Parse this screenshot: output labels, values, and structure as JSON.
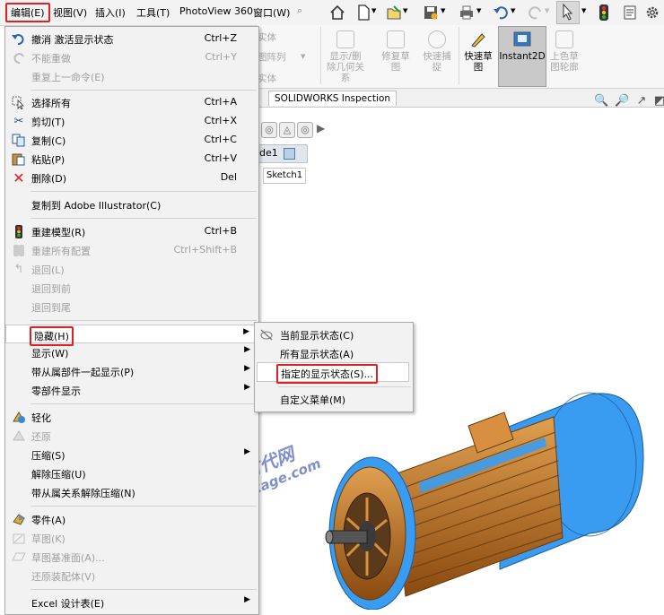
{
  "menubar": {
    "items": [
      "编辑(E)",
      "视图(V)",
      "插入(I)",
      "工具(T)",
      "PhotoView 360",
      "窗口(W)"
    ],
    "icons": [
      "pin-icon",
      "home-icon",
      "new-document-icon",
      "open-icon",
      "save-icon",
      "print-icon",
      "undo-icon",
      "redo-icon",
      "select-arrow-icon",
      "rebuild-traffic-light-icon",
      "file-properties-icon",
      "options-gear-icon"
    ]
  },
  "ribbon": {
    "partial_labels": [
      "实体",
      "图阵列",
      "实体"
    ],
    "buttons": [
      {
        "label": "显示/删除几何关系",
        "enabled": false
      },
      {
        "label": "修复草图",
        "enabled": false
      },
      {
        "label": "快速捕捉",
        "enabled": false
      },
      {
        "label": "快速草图",
        "enabled": true
      },
      {
        "label": "Instant2D",
        "enabled": true,
        "active": true
      },
      {
        "label": "上色草图轮廓",
        "enabled": false
      }
    ]
  },
  "tabs": [
    "SOLIDWORKS Inspection"
  ],
  "canvas": {
    "tree_items": [
      "de1",
      "Sketch1"
    ],
    "watermark_cn": "机械时代网",
    "watermark_url": "www.jxage.com"
  },
  "edit_menu": {
    "items": [
      {
        "label": "撤消 激活显示状态",
        "shortcut": "Ctrl+Z",
        "icon": "undo-icon",
        "enabled": true
      },
      {
        "label": "不能重做",
        "shortcut": "Ctrl+Y",
        "icon": "redo-icon",
        "enabled": false
      },
      {
        "label": "重复上一命令(E)",
        "shortcut": "",
        "icon": "",
        "enabled": false
      },
      {
        "label": "选择所有",
        "shortcut": "Ctrl+A",
        "icon": "select-all-icon",
        "enabled": true
      },
      {
        "label": "剪切(T)",
        "shortcut": "Ctrl+X",
        "icon": "cut-icon",
        "enabled": true
      },
      {
        "label": "复制(C)",
        "shortcut": "Ctrl+C",
        "icon": "copy-icon",
        "enabled": true
      },
      {
        "label": "粘贴(P)",
        "shortcut": "Ctrl+V",
        "icon": "paste-icon",
        "enabled": true
      },
      {
        "label": "删除(D)",
        "shortcut": "Del",
        "icon": "delete-icon",
        "enabled": true
      },
      {
        "label": "复制到 Adobe Illustrator(C)",
        "shortcut": "",
        "icon": "",
        "enabled": true
      },
      {
        "label": "重建模型(R)",
        "shortcut": "Ctrl+B",
        "icon": "rebuild-icon",
        "enabled": true
      },
      {
        "label": "重建所有配置",
        "shortcut": "Ctrl+Shift+B",
        "icon": "rebuild-all-icon",
        "enabled": false
      },
      {
        "label": "退回(L)",
        "shortcut": "",
        "icon": "rollback-icon",
        "enabled": false
      },
      {
        "label": "退回到前",
        "shortcut": "",
        "icon": "",
        "enabled": false
      },
      {
        "label": "退回到尾",
        "shortcut": "",
        "icon": "",
        "enabled": false
      },
      {
        "label": "隐藏(H)",
        "shortcut": "",
        "icon": "",
        "enabled": true,
        "submenu": true
      },
      {
        "label": "显示(W)",
        "shortcut": "",
        "icon": "",
        "enabled": true,
        "submenu": true
      },
      {
        "label": "带从属部件一起显示(P)",
        "shortcut": "",
        "icon": "",
        "enabled": true,
        "submenu": true
      },
      {
        "label": "零部件显示",
        "shortcut": "",
        "icon": "",
        "enabled": true,
        "submenu": true
      },
      {
        "label": "轻化",
        "shortcut": "",
        "icon": "lightweight-icon",
        "enabled": true
      },
      {
        "label": "还原",
        "shortcut": "",
        "icon": "resolve-icon",
        "enabled": false
      },
      {
        "label": "压缩(S)",
        "shortcut": "",
        "icon": "",
        "enabled": true,
        "submenu": true
      },
      {
        "label": "解除压缩(U)",
        "shortcut": "",
        "icon": "",
        "enabled": true
      },
      {
        "label": "带从属关系解除压缩(N)",
        "shortcut": "",
        "icon": "",
        "enabled": true
      },
      {
        "label": "零件(A)",
        "shortcut": "",
        "icon": "part-icon",
        "enabled": true
      },
      {
        "label": "草图(K)",
        "shortcut": "",
        "icon": "sketch-icon",
        "enabled": false
      },
      {
        "label": "草图基准面(A)...",
        "shortcut": "",
        "icon": "sketch-plane-icon",
        "enabled": false
      },
      {
        "label": "还原装配体(V)",
        "shortcut": "",
        "icon": "",
        "enabled": false
      },
      {
        "label": "Excel 设计表(E)",
        "shortcut": "",
        "icon": "",
        "enabled": true,
        "submenu": true
      }
    ]
  },
  "hide_submenu": {
    "items": [
      {
        "label": "当前显示状态(C)",
        "icon": "hide-display-state-icon"
      },
      {
        "label": "所有显示状态(A)",
        "icon": ""
      },
      {
        "label": "指定的显示状态(S)...",
        "icon": ""
      },
      {
        "label": "自定义菜单(M)",
        "icon": ""
      }
    ]
  },
  "colors": {
    "highlight_box": "#e02020",
    "motor_blue": "#3399ee",
    "motor_orange": "#c8781e"
  }
}
